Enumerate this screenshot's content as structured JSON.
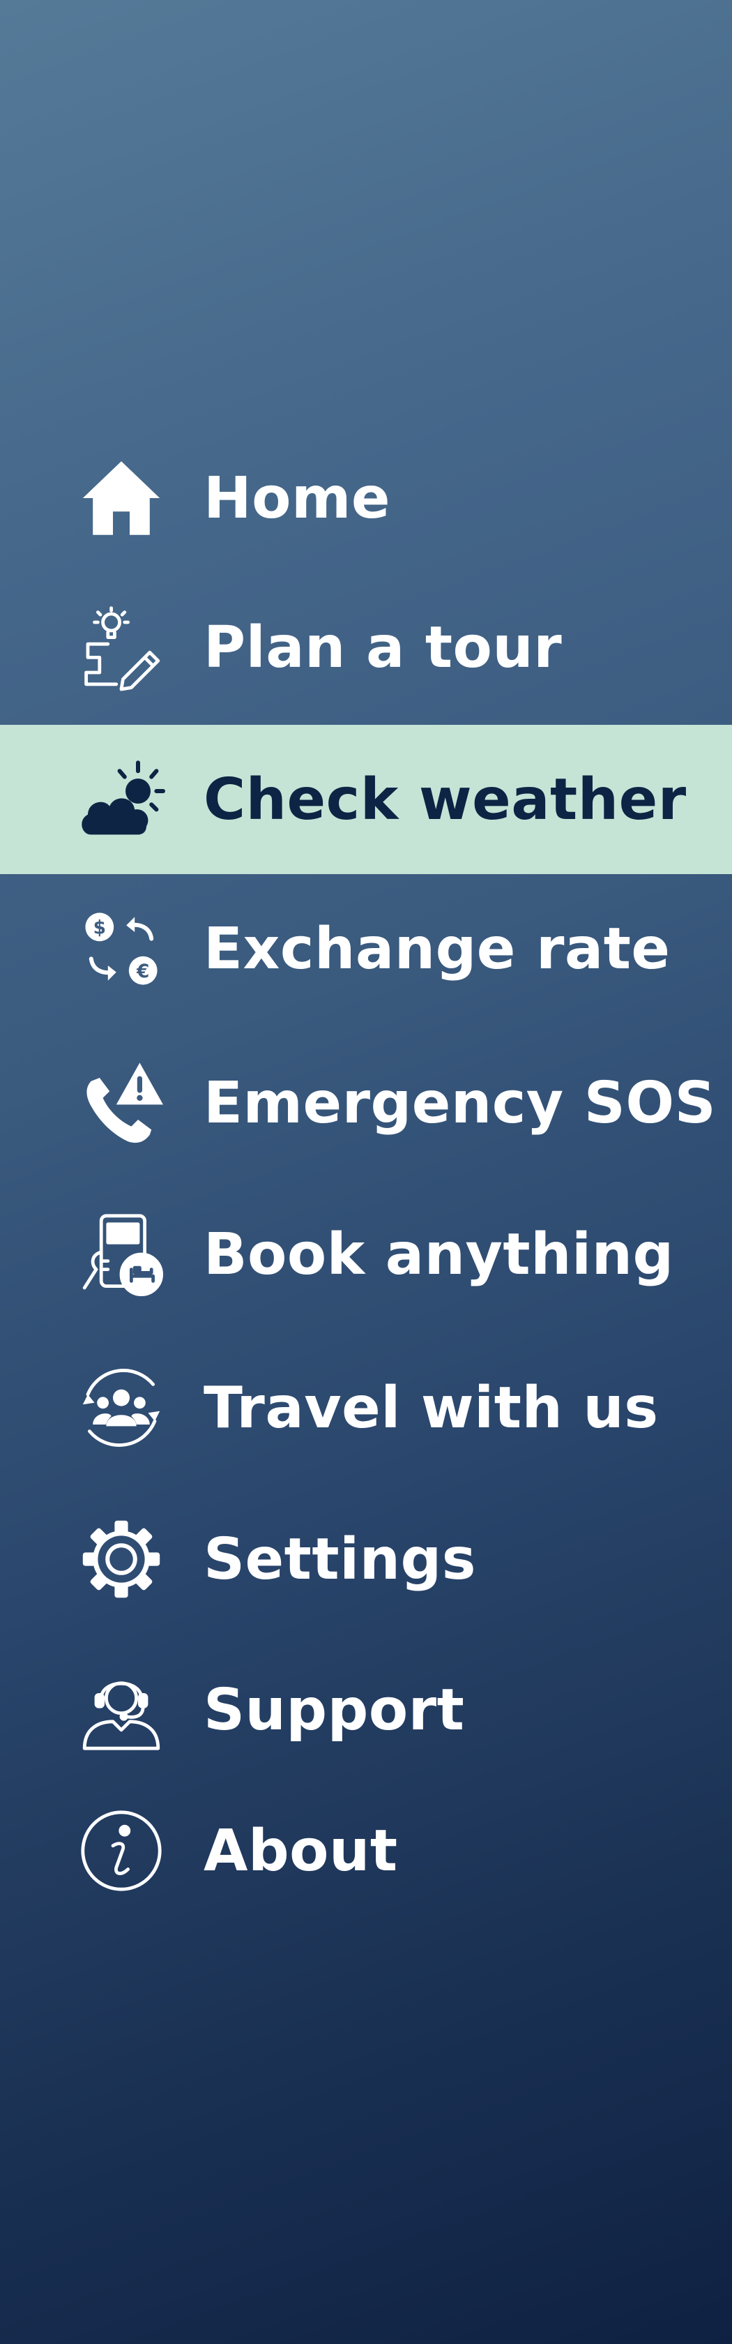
{
  "theme": {
    "background_top": "#557a98",
    "background_bottom": "#0f2143",
    "text_color": "#ffffff",
    "active_background": "#c5e4d6",
    "active_text_color": "#0e2444"
  },
  "menu": {
    "active_index": 2,
    "items": [
      {
        "label": "Home",
        "icon": "home-icon"
      },
      {
        "label": "Plan a tour",
        "icon": "plan-tour-icon"
      },
      {
        "label": "Check weather",
        "icon": "weather-icon"
      },
      {
        "label": "Exchange rate",
        "icon": "currency-exchange-icon"
      },
      {
        "label": "Emergency SOS",
        "icon": "emergency-phone-icon"
      },
      {
        "label": "Book anything",
        "icon": "booking-icon"
      },
      {
        "label": "Travel with us",
        "icon": "group-travel-icon"
      },
      {
        "label": "Settings",
        "icon": "gear-icon"
      },
      {
        "label": "Support",
        "icon": "support-headset-icon"
      },
      {
        "label": "About",
        "icon": "info-icon"
      }
    ]
  }
}
